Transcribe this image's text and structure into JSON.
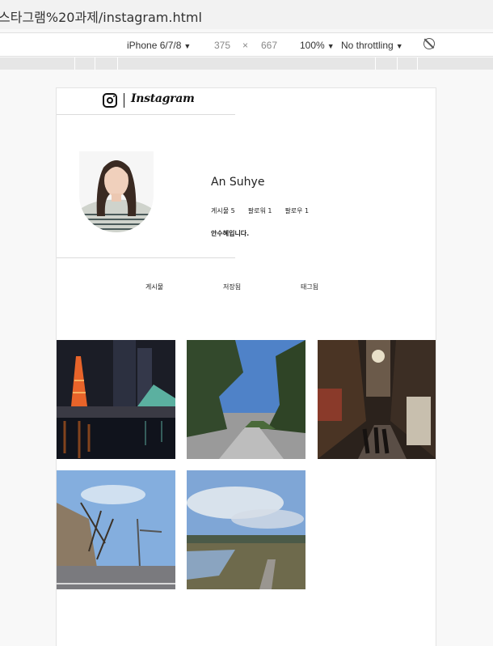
{
  "browser": {
    "url": "스타그램%20과제/instagram.html"
  },
  "devtools": {
    "device": "iPhone 6/7/8",
    "width": "375",
    "times": "×",
    "height": "667",
    "zoom": "100%",
    "throttle": "No throttling",
    "caret": "▼"
  },
  "header": {
    "wordmark": "Instagram"
  },
  "profile": {
    "username": "An Suhye",
    "stats": {
      "posts": "게시물 5",
      "followers": "팔로워 1",
      "following": "팔로우 1"
    },
    "bio": "안수혜입니다."
  },
  "tabs": [
    "게시물",
    "저장됨",
    "태그됨"
  ],
  "photos": [
    {
      "icon": "photo-night-tower"
    },
    {
      "icon": "photo-pine-path"
    },
    {
      "icon": "photo-market-street"
    },
    {
      "icon": "photo-winter-street"
    },
    {
      "icon": "photo-river-landscape"
    }
  ]
}
